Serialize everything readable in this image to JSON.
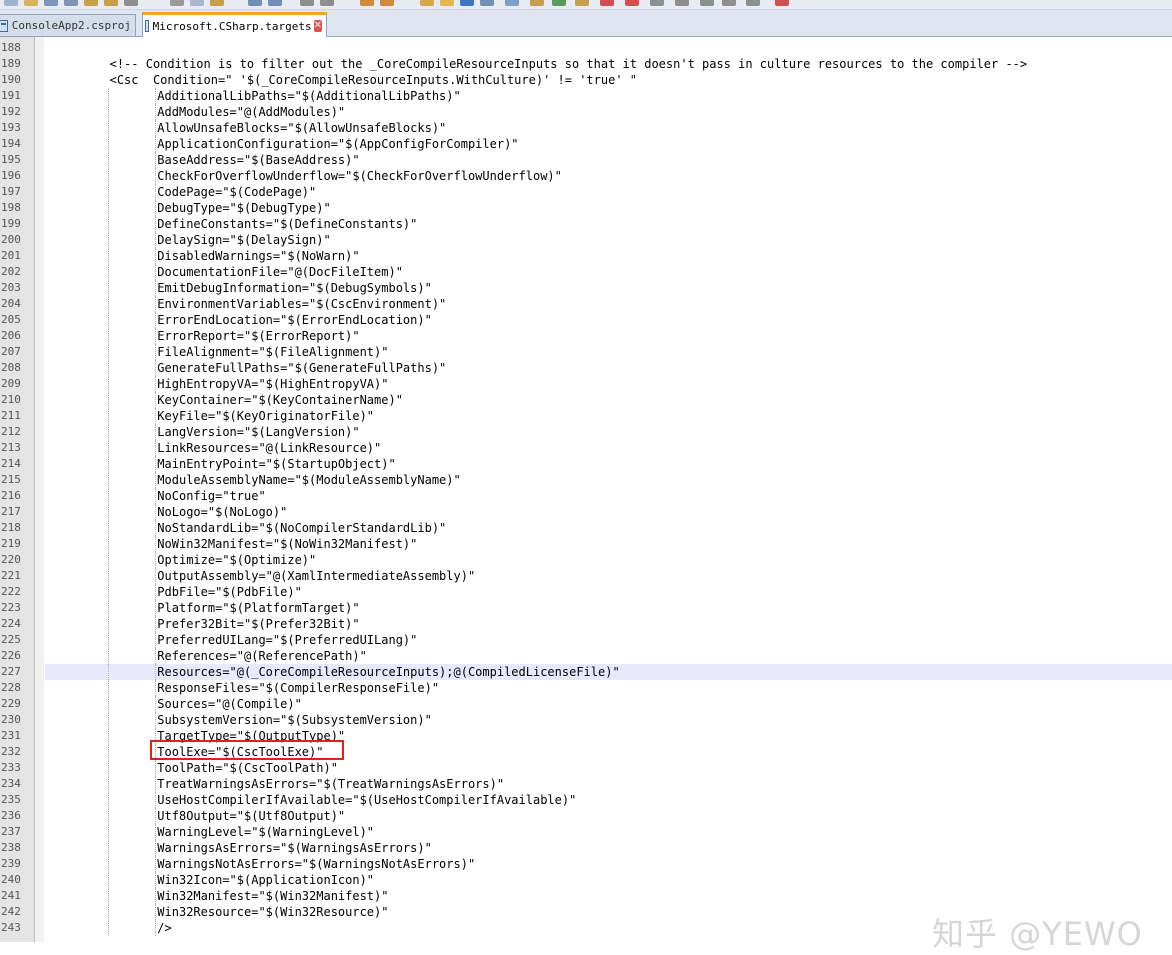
{
  "tabs": [
    {
      "label": "ConsoleApp2.csproj",
      "active": false
    },
    {
      "label": "Microsoft.CSharp.targets",
      "active": true
    }
  ],
  "editor": {
    "current_line": "227",
    "highlighted_line": "232",
    "lines": [
      {
        "num": "188",
        "indent": 0,
        "text": ""
      },
      {
        "num": "189",
        "indent": 8,
        "text": "<!-- Condition is to filter out the _CoreCompileResourceInputs so that it doesn't pass in culture resources to the compiler -->"
      },
      {
        "num": "190",
        "indent": 8,
        "text": "<Csc  Condition=\" '$(_CoreCompileResourceInputs.WithCulture)' != 'true' \""
      },
      {
        "num": "191",
        "indent": 14,
        "text": "AdditionalLibPaths=\"$(AdditionalLibPaths)\""
      },
      {
        "num": "192",
        "indent": 14,
        "text": "AddModules=\"@(AddModules)\""
      },
      {
        "num": "193",
        "indent": 14,
        "text": "AllowUnsafeBlocks=\"$(AllowUnsafeBlocks)\""
      },
      {
        "num": "194",
        "indent": 14,
        "text": "ApplicationConfiguration=\"$(AppConfigForCompiler)\""
      },
      {
        "num": "195",
        "indent": 14,
        "text": "BaseAddress=\"$(BaseAddress)\""
      },
      {
        "num": "196",
        "indent": 14,
        "text": "CheckForOverflowUnderflow=\"$(CheckForOverflowUnderflow)\""
      },
      {
        "num": "197",
        "indent": 14,
        "text": "CodePage=\"$(CodePage)\""
      },
      {
        "num": "198",
        "indent": 14,
        "text": "DebugType=\"$(DebugType)\""
      },
      {
        "num": "199",
        "indent": 14,
        "text": "DefineConstants=\"$(DefineConstants)\""
      },
      {
        "num": "200",
        "indent": 14,
        "text": "DelaySign=\"$(DelaySign)\""
      },
      {
        "num": "201",
        "indent": 14,
        "text": "DisabledWarnings=\"$(NoWarn)\""
      },
      {
        "num": "202",
        "indent": 14,
        "text": "DocumentationFile=\"@(DocFileItem)\""
      },
      {
        "num": "203",
        "indent": 14,
        "text": "EmitDebugInformation=\"$(DebugSymbols)\""
      },
      {
        "num": "204",
        "indent": 14,
        "text": "EnvironmentVariables=\"$(CscEnvironment)\""
      },
      {
        "num": "205",
        "indent": 14,
        "text": "ErrorEndLocation=\"$(ErrorEndLocation)\""
      },
      {
        "num": "206",
        "indent": 14,
        "text": "ErrorReport=\"$(ErrorReport)\""
      },
      {
        "num": "207",
        "indent": 14,
        "text": "FileAlignment=\"$(FileAlignment)\""
      },
      {
        "num": "208",
        "indent": 14,
        "text": "GenerateFullPaths=\"$(GenerateFullPaths)\""
      },
      {
        "num": "209",
        "indent": 14,
        "text": "HighEntropyVA=\"$(HighEntropyVA)\""
      },
      {
        "num": "210",
        "indent": 14,
        "text": "KeyContainer=\"$(KeyContainerName)\""
      },
      {
        "num": "211",
        "indent": 14,
        "text": "KeyFile=\"$(KeyOriginatorFile)\""
      },
      {
        "num": "212",
        "indent": 14,
        "text": "LangVersion=\"$(LangVersion)\""
      },
      {
        "num": "213",
        "indent": 14,
        "text": "LinkResources=\"@(LinkResource)\""
      },
      {
        "num": "214",
        "indent": 14,
        "text": "MainEntryPoint=\"$(StartupObject)\""
      },
      {
        "num": "215",
        "indent": 14,
        "text": "ModuleAssemblyName=\"$(ModuleAssemblyName)\""
      },
      {
        "num": "216",
        "indent": 14,
        "text": "NoConfig=\"true\""
      },
      {
        "num": "217",
        "indent": 14,
        "text": "NoLogo=\"$(NoLogo)\""
      },
      {
        "num": "218",
        "indent": 14,
        "text": "NoStandardLib=\"$(NoCompilerStandardLib)\""
      },
      {
        "num": "219",
        "indent": 14,
        "text": "NoWin32Manifest=\"$(NoWin32Manifest)\""
      },
      {
        "num": "220",
        "indent": 14,
        "text": "Optimize=\"$(Optimize)\""
      },
      {
        "num": "221",
        "indent": 14,
        "text": "OutputAssembly=\"@(XamlIntermediateAssembly)\""
      },
      {
        "num": "222",
        "indent": 14,
        "text": "PdbFile=\"$(PdbFile)\""
      },
      {
        "num": "223",
        "indent": 14,
        "text": "Platform=\"$(PlatformTarget)\""
      },
      {
        "num": "224",
        "indent": 14,
        "text": "Prefer32Bit=\"$(Prefer32Bit)\""
      },
      {
        "num": "225",
        "indent": 14,
        "text": "PreferredUILang=\"$(PreferredUILang)\""
      },
      {
        "num": "226",
        "indent": 14,
        "text": "References=\"@(ReferencePath)\""
      },
      {
        "num": "227",
        "indent": 14,
        "text": "Resources=\"@(_CoreCompileResourceInputs);@(CompiledLicenseFile)\""
      },
      {
        "num": "228",
        "indent": 14,
        "text": "ResponseFiles=\"$(CompilerResponseFile)\""
      },
      {
        "num": "229",
        "indent": 14,
        "text": "Sources=\"@(Compile)\""
      },
      {
        "num": "230",
        "indent": 14,
        "text": "SubsystemVersion=\"$(SubsystemVersion)\""
      },
      {
        "num": "231",
        "indent": 14,
        "text": "TargetType=\"$(OutputType)\""
      },
      {
        "num": "232",
        "indent": 14,
        "text": "ToolExe=\"$(CscToolExe)\""
      },
      {
        "num": "233",
        "indent": 14,
        "text": "ToolPath=\"$(CscToolPath)\""
      },
      {
        "num": "234",
        "indent": 14,
        "text": "TreatWarningsAsErrors=\"$(TreatWarningsAsErrors)\""
      },
      {
        "num": "235",
        "indent": 14,
        "text": "UseHostCompilerIfAvailable=\"$(UseHostCompilerIfAvailable)\""
      },
      {
        "num": "236",
        "indent": 14,
        "text": "Utf8Output=\"$(Utf8Output)\""
      },
      {
        "num": "237",
        "indent": 14,
        "text": "WarningLevel=\"$(WarningLevel)\""
      },
      {
        "num": "238",
        "indent": 14,
        "text": "WarningsAsErrors=\"$(WarningsAsErrors)\""
      },
      {
        "num": "239",
        "indent": 14,
        "text": "WarningsNotAsErrors=\"$(WarningsNotAsErrors)\""
      },
      {
        "num": "240",
        "indent": 14,
        "text": "Win32Icon=\"$(ApplicationIcon)\""
      },
      {
        "num": "241",
        "indent": 14,
        "text": "Win32Manifest=\"$(Win32Manifest)\""
      },
      {
        "num": "242",
        "indent": 14,
        "text": "Win32Resource=\"$(Win32Resource)\""
      },
      {
        "num": "243",
        "indent": 14,
        "text": "/>"
      }
    ]
  },
  "watermark": "知乎 @YEWO",
  "colors": {
    "highlight_box": "#e0201a",
    "active_tab_accent": "#f5a623",
    "current_line_bg": "#e8e8ff"
  }
}
